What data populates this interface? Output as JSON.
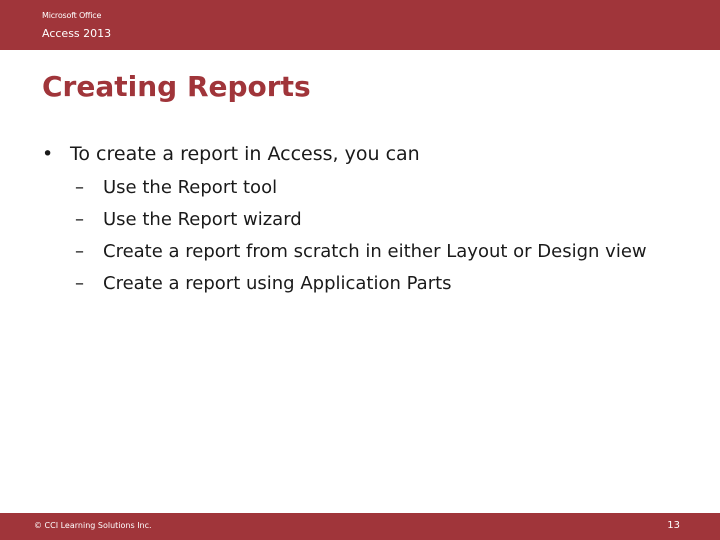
{
  "header": {
    "line1": "Microsoft Office",
    "line2": "Access 2013"
  },
  "slide": {
    "title": "Creating Reports",
    "bullet_marker": "•",
    "dash_marker": "–",
    "main_bullet": "To create a report in Access, you can",
    "sub_bullets": [
      "Use the Report tool",
      "Use the Report wizard",
      "Create a report from scratch in either Layout or Design view",
      "Create a report using Application Parts"
    ]
  },
  "footer": {
    "copyright": "© CCI Learning Solutions Inc.",
    "page_number": "13"
  },
  "colors": {
    "accent": "#a0353a",
    "text": "#1a1a1a",
    "background": "#ffffff"
  }
}
